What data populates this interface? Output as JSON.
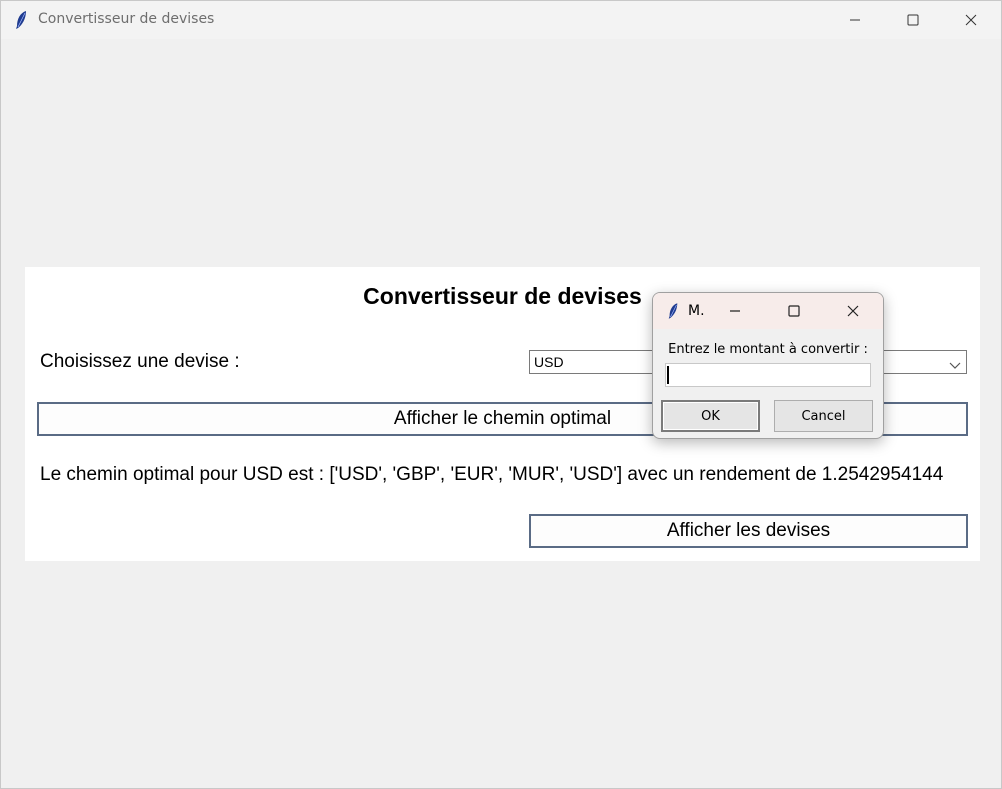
{
  "window": {
    "title": "Convertisseur de devises"
  },
  "panel": {
    "heading": "Convertisseur de devises",
    "choose_label": "Choisissez une devise :",
    "currency_select": {
      "selected": "USD"
    },
    "optimal_path_button": "Afficher le chemin optimal",
    "result_text": "Le chemin optimal pour USD est : ['USD', 'GBP', 'EUR', 'MUR', 'USD'] avec un rendement de 1.2542954144",
    "show_currencies_button": "Afficher les devises"
  },
  "dialog": {
    "title": "M.",
    "prompt": "Entrez le montant à convertir :",
    "input_value": "",
    "ok_label": "OK",
    "cancel_label": "Cancel"
  },
  "icons": {
    "app": "feather-icon",
    "minimize": "minimize-icon",
    "maximize": "maximize-icon",
    "close": "close-icon",
    "dropdown": "chevron-down-icon"
  }
}
